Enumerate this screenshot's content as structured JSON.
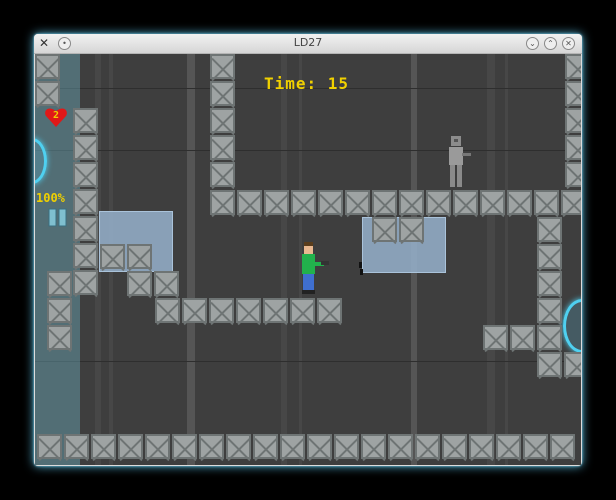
{
  "window": {
    "title": "LD27"
  },
  "hud": {
    "time_label": "Time: 15",
    "lives": "2",
    "energy_percent": "100%"
  },
  "icons": [
    "app-icon",
    "minimize-icon",
    "maximize-icon",
    "close-icon",
    "heart-icon",
    "jetpack-icon"
  ],
  "colors": {
    "hud_text": "#f0d000",
    "portal": "#4fd0f0",
    "background": "#3e3e3e"
  }
}
